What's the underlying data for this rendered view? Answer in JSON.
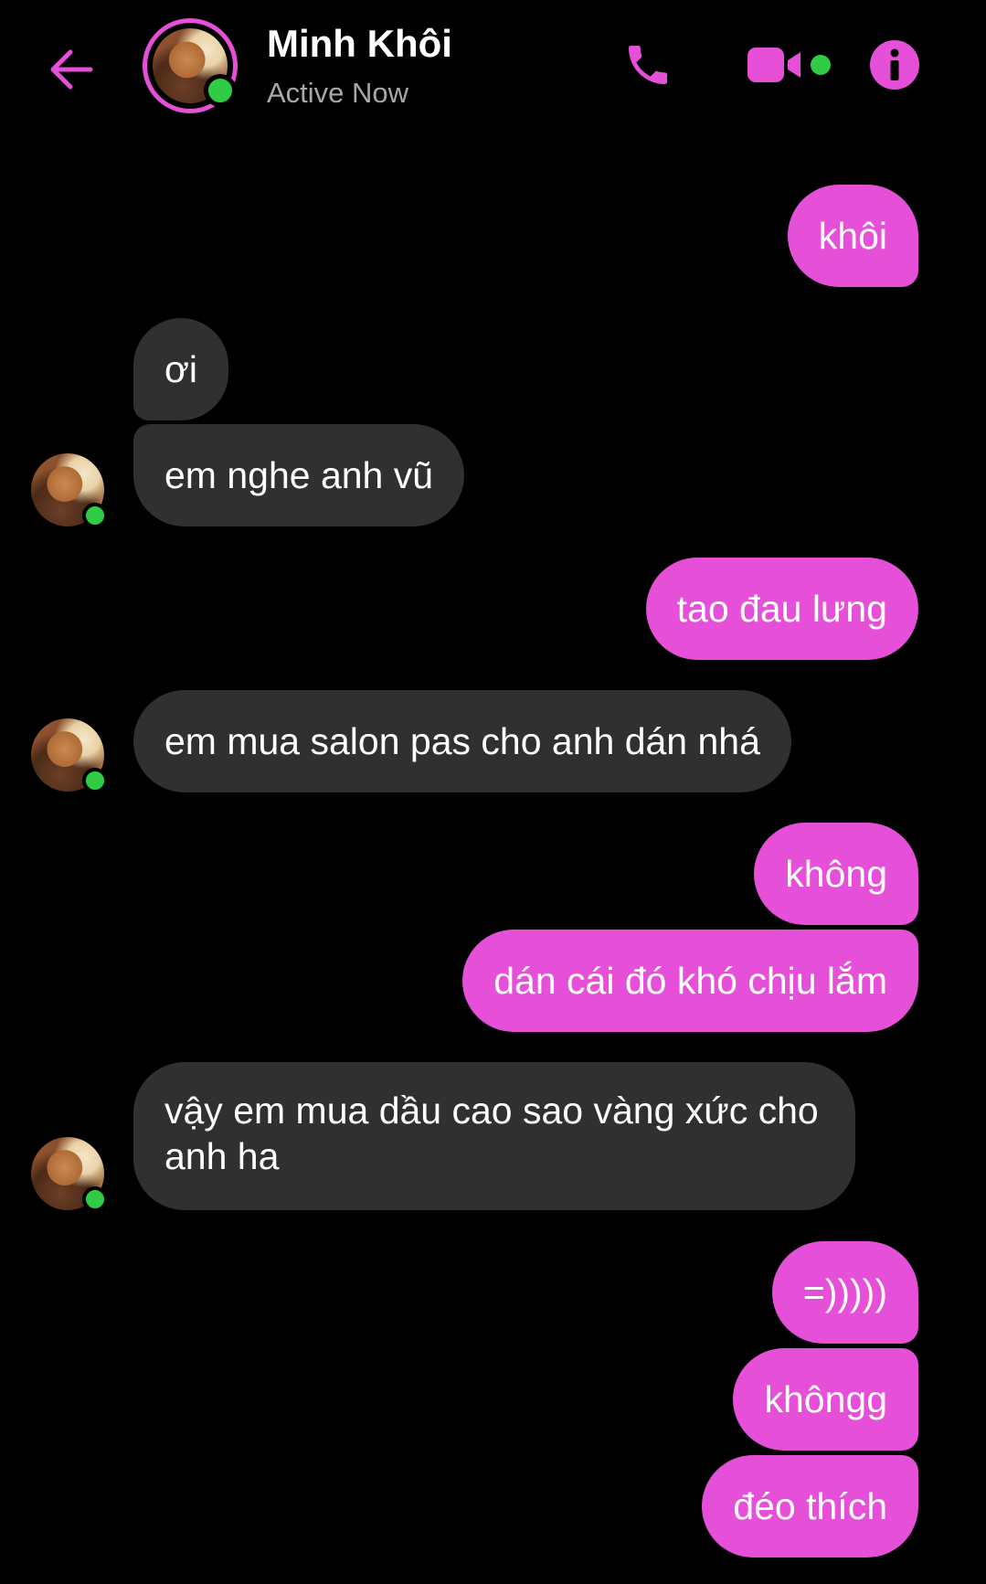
{
  "header": {
    "name": "Minh Khôi",
    "status": "Active Now",
    "back_icon": "arrow-left-icon",
    "call_icon": "phone-icon",
    "video_icon": "video-camera-icon",
    "info_icon": "info-icon",
    "accent_color": "#e64fd8",
    "online_color": "#31cc46"
  },
  "messages": [
    {
      "from": "me",
      "text": "khôi"
    },
    {
      "from": "them",
      "text": "ơi"
    },
    {
      "from": "them",
      "text": "em nghe anh vũ"
    },
    {
      "from": "me",
      "text": "tao đau lưng"
    },
    {
      "from": "them",
      "text": "em mua salon pas cho anh dán nhá"
    },
    {
      "from": "me",
      "text": "không"
    },
    {
      "from": "me",
      "text": "dán cái đó khó chịu lắm"
    },
    {
      "from": "them",
      "text": "vậy em mua dầu cao sao vàng xức cho anh ha"
    },
    {
      "from": "me",
      "text": "=)))))"
    },
    {
      "from": "me",
      "text": "khôngg"
    },
    {
      "from": "me",
      "text": "đéo thích"
    }
  ],
  "colors": {
    "background": "#000000",
    "sent_bubble": "#e64fd8",
    "received_bubble": "#303030",
    "status_text": "#a8a8a8"
  }
}
